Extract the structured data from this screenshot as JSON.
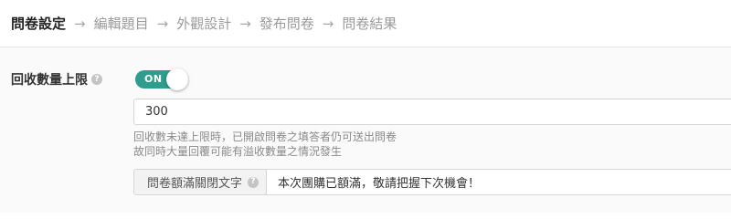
{
  "steps": [
    {
      "label": "問卷設定",
      "active": true
    },
    {
      "label": "編輯題目",
      "active": false
    },
    {
      "label": "外觀設計",
      "active": false
    },
    {
      "label": "發布問卷",
      "active": false
    },
    {
      "label": "問卷結果",
      "active": false
    }
  ],
  "arrow_glyph": "→",
  "field": {
    "label": "回收數量上限",
    "help_glyph": "?",
    "toggle": {
      "text": "ON",
      "state": "on",
      "color": "#2e9d8e"
    },
    "limit_value": "300",
    "hint_lines": [
      "回收數未達上限時，已開啟問卷之填答者仍可送出問卷",
      "故同時大量回覆可能有溢收數量之情況發生"
    ],
    "close_text_label": "問卷額滿關閉文字",
    "close_text_value": "本次團購已額滿，敬請把握下次機會！"
  }
}
